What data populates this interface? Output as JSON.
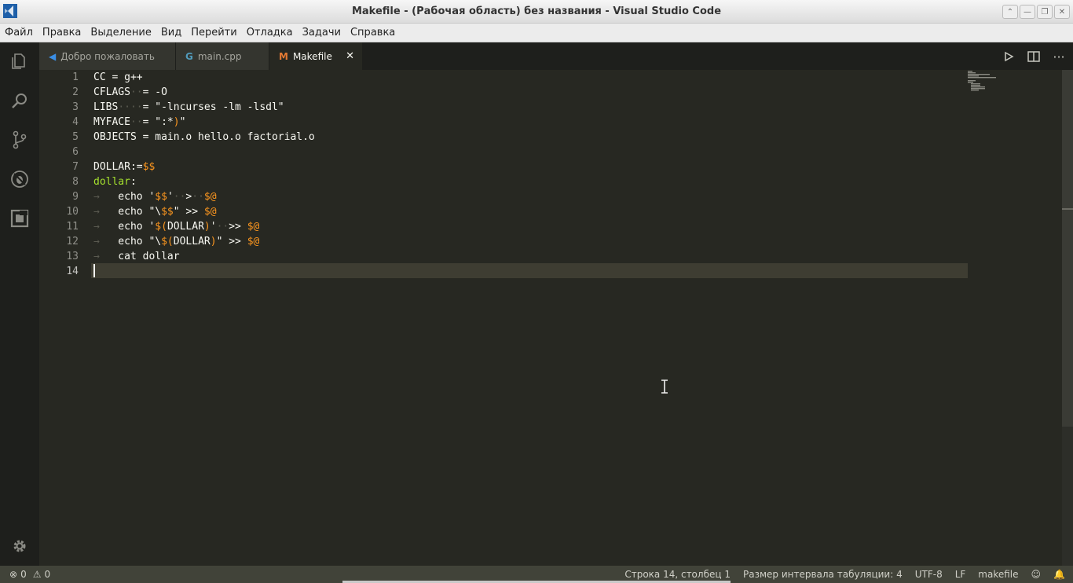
{
  "window": {
    "title": "Makefile - (Рабочая область) без названия - Visual Studio Code"
  },
  "menu": [
    "Файл",
    "Правка",
    "Выделение",
    "Вид",
    "Перейти",
    "Отладка",
    "Задачи",
    "Справка"
  ],
  "tabs": [
    {
      "label": "Добро пожаловать",
      "icon": "vscode-logo-icon",
      "active": false
    },
    {
      "label": "main.cpp",
      "icon": "cpp-file-icon",
      "active": false
    },
    {
      "label": "Makefile",
      "icon": "makefile-icon",
      "active": true
    }
  ],
  "editor": {
    "line_numbers": [
      "1",
      "2",
      "3",
      "4",
      "5",
      "6",
      "7",
      "8",
      "9",
      "10",
      "11",
      "12",
      "13",
      "14"
    ],
    "lines": [
      "CC = g++",
      "CFLAGS··= -O",
      "LIBS····= \"-lncurses -lm -lsdl\"",
      "MYFACE··= \":*)\"",
      "OBJECTS = main.o hello.o factorial.o",
      "",
      "DOLLAR:=$$",
      "dollar:",
      "→   echo '$$'··>··$@",
      "→   echo \"\\$$\" >> $@",
      "→   echo '$(DOLLAR)'··>> $@",
      "→   echo \"\\$(DOLLAR)\" >> $@",
      "→   cat dollar",
      ""
    ],
    "cursor_line": 14
  },
  "status": {
    "errors": "0",
    "warnings": "0",
    "position": "Строка 14, столбец 1",
    "indent": "Размер интервала табуляции: 4",
    "encoding": "UTF-8",
    "eol": "LF",
    "language": "makefile"
  },
  "colors": {
    "editor_bg": "#272822",
    "activity_bg": "#1e1f1c",
    "variable": "#fd971f",
    "target": "#a6e22e",
    "status_bg": "#414339"
  }
}
